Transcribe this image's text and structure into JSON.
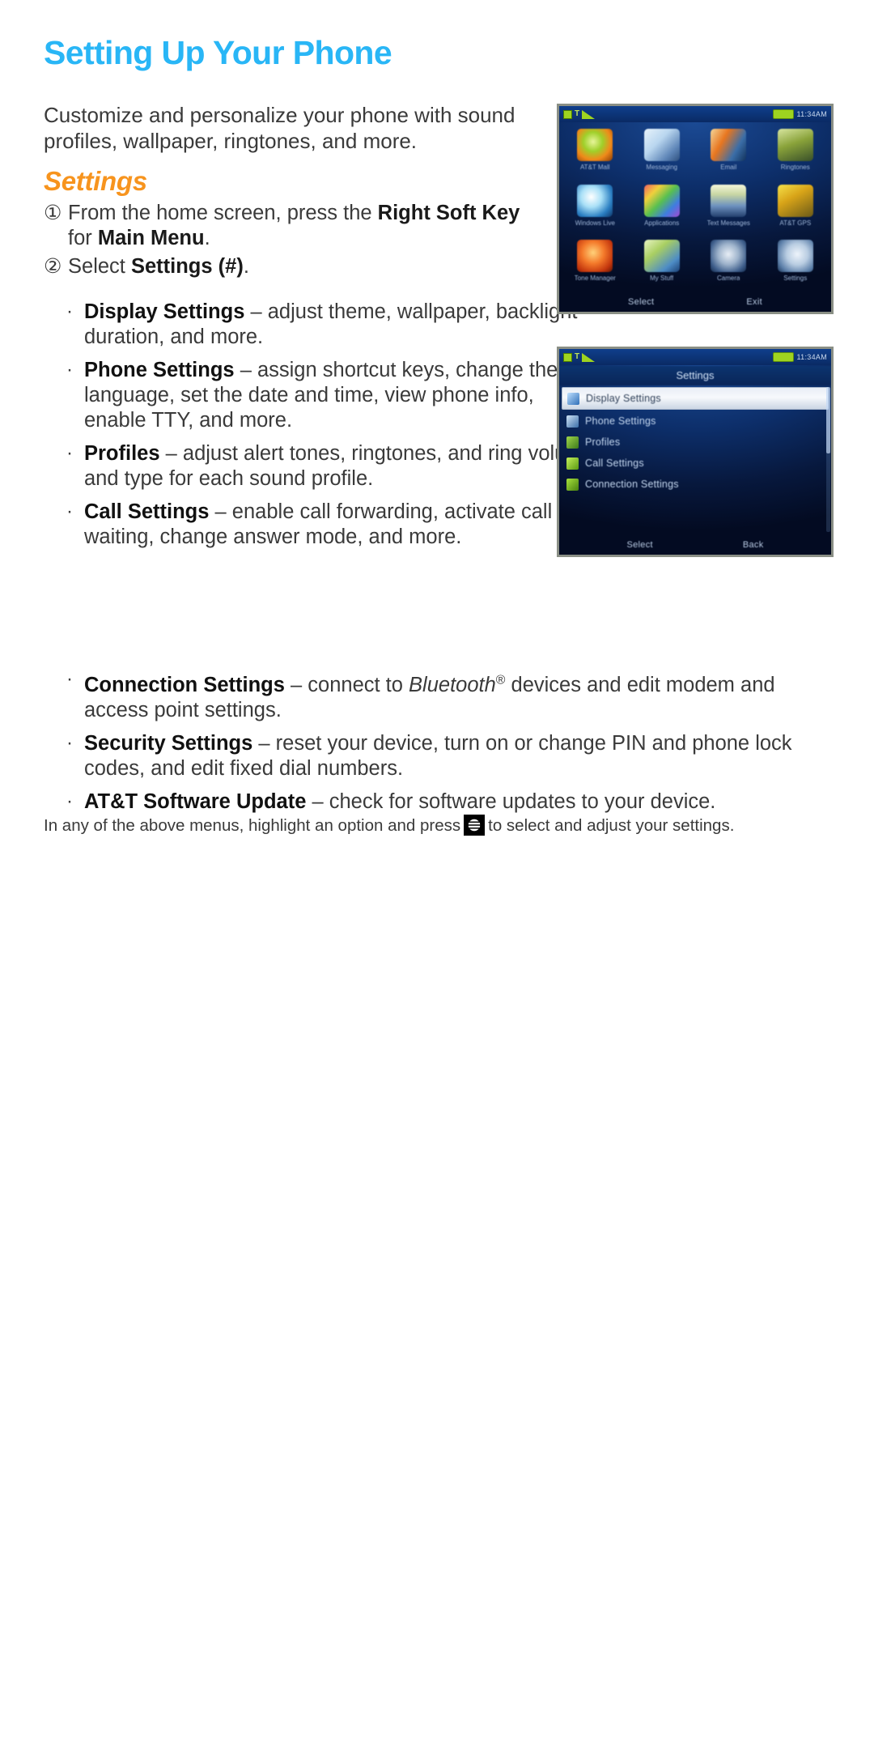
{
  "document": {
    "title": "Setting Up Your Phone",
    "title_color": "#29b6f6",
    "intro": "Customize and personalize your phone with sound profiles, wallpaper, ringtones, and more.",
    "section_heading": "Settings",
    "section_heading_color": "#f7941e"
  },
  "steps": [
    {
      "marker": "①",
      "text_html": "From the home screen, press the <b>Right Soft Key</b> for <b>Main Menu</b>."
    },
    {
      "marker": "②",
      "text_html": "Select <b>Settings (#)</b>."
    }
  ],
  "bullets_narrow": [
    {
      "marker": "·",
      "term": "Display Settings",
      "description": " – adjust theme, wallpaper, backlight duration, and more.",
      "html": "<b>Display Settings</b> – adjust theme, wallpaper, backlight duration, and more."
    },
    {
      "marker": "·",
      "term": "Phone Settings",
      "description": " – assign shortcut keys, change the language, set the date and time, view phone info, enable TTY, and more.",
      "html": "<b>Phone Settings</b> – assign shortcut keys, change the language, set the date and time, view phone info, enable TTY, and more."
    },
    {
      "marker": "·",
      "term": "Profiles",
      "description": " – adjust alert tones, ringtones, and ring volume and type for each sound profile.",
      "html": "<b>Profiles</b> – adjust alert tones, ringtones, and ring volume and type for each sound profile."
    },
    {
      "marker": "·",
      "term": "Call Settings",
      "description": " – enable call forwarding, activate call waiting, change answer mode, and more.",
      "html": "<b>Call Settings</b> – enable call forwarding, activate call waiting, change answer mode, and more."
    }
  ],
  "bullets_wide": [
    {
      "marker": "·",
      "term": "Connection Settings",
      "description": " – connect to Bluetooth® devices and edit modem and access point settings.",
      "html": "<b>Connection Settings</b> – connect to <i>Bluetooth</i><sup>®</sup> devices and edit modem and access point settings."
    },
    {
      "marker": "·",
      "term": "Security Settings",
      "description": " – reset your device, turn on or change PIN and phone lock codes, and edit fixed dial numbers.",
      "html": "<b>Security Settings</b> – reset your device, turn on or change PIN and phone lock codes, and edit fixed dial numbers."
    },
    {
      "marker": "·",
      "term": "AT&T Software Update",
      "description": " – check for software updates to your device.",
      "html": "<b>AT&amp;T Software Update</b> – check for software updates to your device."
    }
  ],
  "footnote": {
    "before_icon": "In any of the above menus, highlight an option and press",
    "icon": "att-globe-icon",
    "after_icon": "to select and adjust your settings."
  },
  "screenshots": [
    {
      "id": "main-menu",
      "name": "phone-screenshot-main-menu",
      "status_bar": {
        "time": "11:34AM"
      },
      "tiles": [
        {
          "label": "AT&T Mall",
          "art": "radial-gradient(circle at 45% 40%, #e8f59a 0%, #9fd02a 35%, #f08a1a 65%, #8a3c06 100%)"
        },
        {
          "label": "Messaging",
          "art": "linear-gradient(135deg, #e8f3fb 0%, #b9d6ef 40%, #5f86b8 75%, #2d4f7e 100%)"
        },
        {
          "label": "Email",
          "art": "linear-gradient(120deg, #f4d79a 0%, #e8761f 35%, #3b6ea8 70%, #12325c 100%)"
        },
        {
          "label": "Ringtones",
          "art": "linear-gradient(160deg, #d8e6a0 0%, #8aa33a 45%, #39502a 100%)"
        },
        {
          "label": "Windows Live",
          "art": "radial-gradient(circle at 40% 38%, #ffffff 0%, #a9e0f7 35%, #2a7ec2 70%, #0e3566 100%)"
        },
        {
          "label": "Applications",
          "art": "linear-gradient(135deg, #f06060 0%, #f0d03c 25%, #58c050 50%, #3f7de0 75%, #a44ad0 100%)"
        },
        {
          "label": "Text Messages",
          "art": "linear-gradient(to bottom, #f4f6da 0%, #c9d7a4 30%, #6f93c0 65%, #23406e 100%)"
        },
        {
          "label": "AT&T GPS",
          "art": "linear-gradient(150deg, #f5e14a 0%, #d8a418 40%, #6b5a18 100%)"
        },
        {
          "label": "Tone Manager",
          "art": "radial-gradient(circle at 45% 40%, #ffd27a 0%, #f4792a 40%, #c2350d 75%, #5e1703 100%)"
        },
        {
          "label": "My Stuff",
          "art": "linear-gradient(140deg, #e9f4c4 0%, #a9cf62 35%, #4d8cc6 75%, #1b3f73 100%)"
        },
        {
          "label": "Camera",
          "art": "radial-gradient(circle at 50% 45%, #e8eef6 0%, #9fb4cc 40%, #3f5f8c 75%, #132a4d 100%)"
        },
        {
          "label": "Settings",
          "art": "radial-gradient(circle at 55% 45%, #eef4fb 0%, #b9cde2 40%, #5b7ea8 75%, #1c3759 100%)"
        }
      ],
      "soft_keys": [
        "Select",
        "Exit"
      ]
    },
    {
      "id": "settings-menu",
      "name": "phone-screenshot-settings-menu",
      "status_bar": {
        "time": "11:34AM"
      },
      "screen_title": "Settings",
      "rows": [
        {
          "label": "Display Settings",
          "selected": true,
          "icon_color": "linear-gradient(135deg,#bfe0ff,#2f6fb8)"
        },
        {
          "label": "Phone Settings",
          "selected": false,
          "icon_color": "linear-gradient(135deg,#cfe2f5,#3a6ea8)"
        },
        {
          "label": "Profiles",
          "selected": false,
          "icon_color": "linear-gradient(135deg,#9fd64a,#3c7a1b)"
        },
        {
          "label": "Call Settings",
          "selected": false,
          "icon_color": "linear-gradient(135deg,#c4f05a,#5a9a12)"
        },
        {
          "label": "Connection Settings",
          "selected": false,
          "icon_color": "linear-gradient(135deg,#a8e23c,#48800f)"
        }
      ],
      "soft_keys": [
        "Select",
        "Back"
      ]
    }
  ]
}
